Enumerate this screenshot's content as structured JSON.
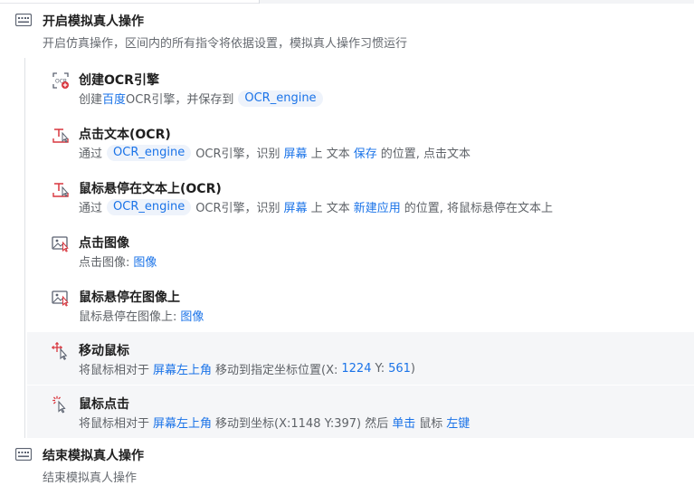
{
  "colors": {
    "link": "#1a73e8",
    "chip_bg": "#eef3fb",
    "icon_red": "#d9363e",
    "text_muted": "#5f6368"
  },
  "start_block": {
    "icon": "block-start-icon",
    "title": "开启模拟真人操作",
    "desc": "开启仿真操作，区间内的所有指令将依据设置，模拟真人操作习惯运行"
  },
  "steps": [
    {
      "icon": "ocr-engine-icon",
      "title": "创建OCR引擎",
      "desc": {
        "t1": "创建",
        "l1": "百度",
        "t2": "OCR引擎，并保存到",
        "chip": "OCR_engine"
      }
    },
    {
      "icon": "ocr-click-text-icon",
      "title": "点击文本(OCR)",
      "desc": {
        "t1": "通过",
        "chip": "OCR_engine",
        "t2": "OCR引擎，识别",
        "l1": "屏幕",
        "t3": "上 文本",
        "l2": "保存",
        "t4": "的位置, 点击文本"
      }
    },
    {
      "icon": "ocr-hover-text-icon",
      "title": "鼠标悬停在文本上(OCR)",
      "desc": {
        "t1": "通过",
        "chip": "OCR_engine",
        "t2": "OCR引擎，识别",
        "l1": "屏幕",
        "t3": "上 文本",
        "l2": "新建应用",
        "t4": "的位置, 将鼠标悬停在文本上"
      }
    },
    {
      "icon": "image-click-icon",
      "title": "点击图像",
      "desc": {
        "t1": "点击图像:",
        "l1": "图像"
      }
    },
    {
      "icon": "image-hover-icon",
      "title": "鼠标悬停在图像上",
      "desc": {
        "t1": "鼠标悬停在图像上:",
        "l1": "图像"
      }
    },
    {
      "icon": "mouse-move-icon",
      "title": "移动鼠标",
      "desc": {
        "t1": "将鼠标相对于",
        "l1": "屏幕左上角",
        "t2": "移动到指定坐标位置(X:",
        "l2": "1224",
        "t3": "Y:",
        "l3": "561",
        "t4": ")"
      }
    },
    {
      "icon": "mouse-click-icon",
      "title": "鼠标点击",
      "desc": {
        "t1": "将鼠标相对于",
        "l1": "屏幕左上角",
        "t2": "移动到坐标(X:1148 Y:397) 然后",
        "l2": "单击",
        "t3": "鼠标",
        "l3": "左键"
      }
    }
  ],
  "end_block": {
    "icon": "block-end-icon",
    "title": "结束模拟真人操作",
    "desc": "结束模拟真人操作"
  }
}
